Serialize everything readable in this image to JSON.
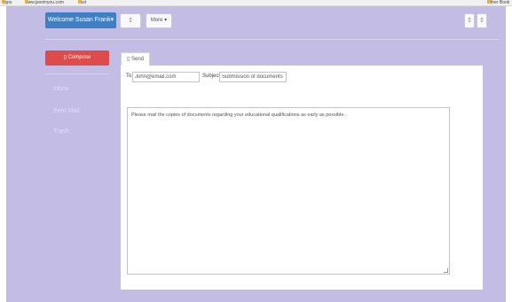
{
  "bookmarks": {
    "items": [
      "Apps",
      "www.jsoninyou.com",
      "Just"
    ],
    "right_label": "Other Book"
  },
  "header": {
    "user_menu_label": "Welcome Susan Frank",
    "user_menu_caret": "▾",
    "icon_button_glyph": "▯",
    "more_label": "More",
    "more_caret": "▾",
    "right_button_1_glyph": "▯",
    "right_button_2_glyph": "▯"
  },
  "sidebar": {
    "compose_label": "Compose",
    "compose_icon": "pencil-icon",
    "items": [
      {
        "label": "Inbox"
      },
      {
        "label": "Sent Mail"
      },
      {
        "label": "Trash"
      }
    ]
  },
  "tab": {
    "label": "Send",
    "icon": "send-icon"
  },
  "form": {
    "to_label": "To",
    "to_value": "John@email.com",
    "subject_label": "Subject",
    "subject_value": "Submission of documents",
    "body_text": "Please mail the copies of documents regarding your educational qualifications as early as possible."
  },
  "colors": {
    "background": "#c3bde6",
    "primary": "#3f7fc4",
    "compose": "#dd4b4b"
  }
}
